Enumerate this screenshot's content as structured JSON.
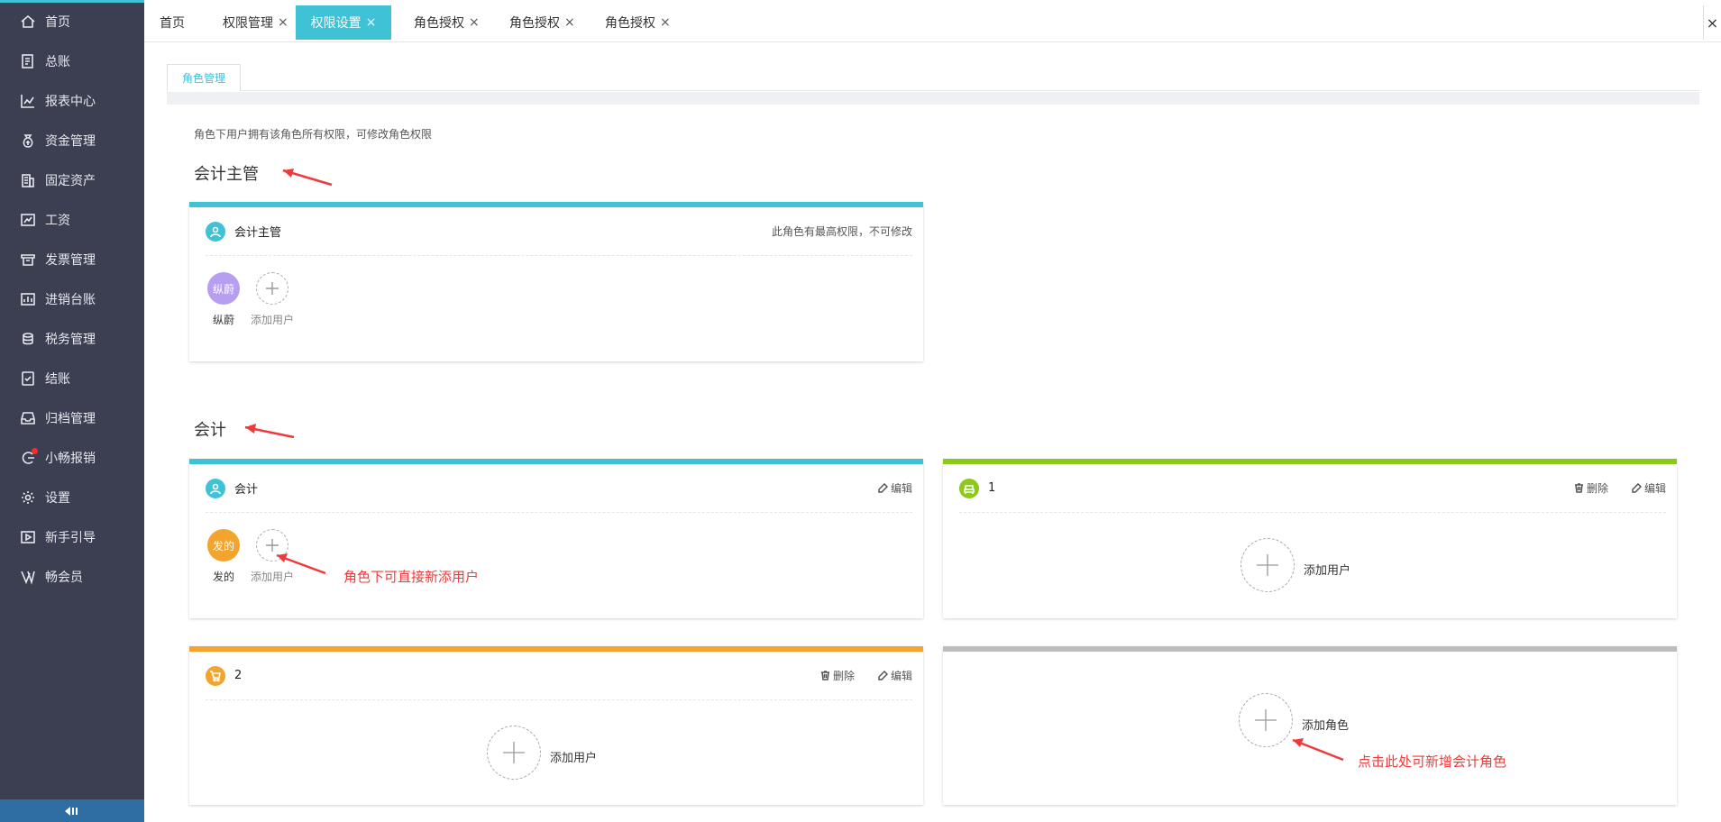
{
  "sidebar": {
    "items": [
      {
        "label": "首页",
        "icon": "home-icon"
      },
      {
        "label": "总账",
        "icon": "ledger-icon"
      },
      {
        "label": "报表中心",
        "icon": "chart-icon"
      },
      {
        "label": "资金管理",
        "icon": "money-bag-icon"
      },
      {
        "label": "固定资产",
        "icon": "building-icon"
      },
      {
        "label": "工资",
        "icon": "salary-icon"
      },
      {
        "label": "发票管理",
        "icon": "invoice-icon"
      },
      {
        "label": "进销台账",
        "icon": "inventory-icon"
      },
      {
        "label": "税务管理",
        "icon": "tax-icon"
      },
      {
        "label": "结账",
        "icon": "checkout-icon"
      },
      {
        "label": "归档管理",
        "icon": "archive-icon"
      },
      {
        "label": "小畅报销",
        "icon": "reimburse-icon"
      },
      {
        "label": "设置",
        "icon": "gear-icon"
      },
      {
        "label": "新手引导",
        "icon": "play-icon"
      },
      {
        "label": "畅会员",
        "icon": "vip-icon"
      }
    ]
  },
  "tabs": [
    {
      "label": "首页",
      "closable": false,
      "active": false
    },
    {
      "label": "权限管理",
      "closable": true,
      "active": false
    },
    {
      "label": "权限设置",
      "closable": true,
      "active": true
    },
    {
      "label": "角色授权",
      "closable": true,
      "active": false
    },
    {
      "label": "角色授权",
      "closable": true,
      "active": false
    },
    {
      "label": "角色授权",
      "closable": true,
      "active": false
    }
  ],
  "tab_close_glyph": "×",
  "subtab": {
    "label": "角色管理"
  },
  "description": "角色下用户拥有该角色所有权限，可修改角色权限",
  "sections": {
    "supervisor": {
      "title": "会计主管"
    },
    "accountant": {
      "title": "会计"
    }
  },
  "cards": {
    "supervisor": {
      "name": "会计主管",
      "note": "此角色有最高权限，不可修改",
      "bar_color": "#3fc1d6",
      "icon_color": "#3fc1d6",
      "users": [
        {
          "avatar_text": "纵蔚",
          "name": "纵蔚",
          "color": "#b69ef0"
        }
      ],
      "add_label": "添加用户"
    },
    "accountant": {
      "name": "会计",
      "edit_label": "编辑",
      "bar_color": "#3fc1d6",
      "icon_color": "#3fc1d6",
      "users": [
        {
          "avatar_text": "发的",
          "name": "发的",
          "color": "#f2a42c"
        }
      ],
      "add_label": "添加用户"
    },
    "role1": {
      "name": "1",
      "delete_label": "删除",
      "edit_label": "编辑",
      "bar_color": "#8cc919",
      "icon_color": "#8cc919",
      "add_label": "添加用户"
    },
    "role2": {
      "name": "2",
      "delete_label": "删除",
      "edit_label": "编辑",
      "bar_color": "#f2a42c",
      "icon_color": "#f2a42c",
      "add_label": "添加用户"
    },
    "add_role": {
      "bar_color": "#bdbdbd",
      "add_label": "添加角色"
    }
  },
  "annotations": {
    "add_user_hint": "角色下可直接新添用户",
    "add_role_hint": "点击此处可新增会计角色",
    "color": "#ee3a3a"
  },
  "colors": {
    "sidebar_bg": "#3b3f51",
    "accent": "#3fc1d6"
  }
}
